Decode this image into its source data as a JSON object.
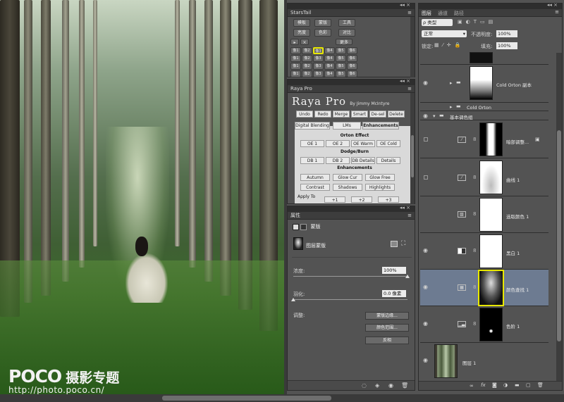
{
  "watermark": {
    "brand": "POCO",
    "sub": "摄影专题",
    "url": "http://photo.poco.cn/"
  },
  "starstail": {
    "title": "StarsTail",
    "row1": [
      "模板",
      "蒙版",
      "工具"
    ],
    "row2": [
      "亮度",
      "色彩",
      "对比"
    ],
    "row3_left": [
      "▸",
      "×"
    ],
    "row3_right": "更多",
    "grid": [
      "像1",
      "像2",
      "像3",
      "像4",
      "像5",
      "像6",
      "像1",
      "像2",
      "像3",
      "像4",
      "像5",
      "像6",
      "像1",
      "像2",
      "像3",
      "像4",
      "像5",
      "像6",
      "像1",
      "像2",
      "像3",
      "像4",
      "像5",
      "像6"
    ]
  },
  "raya": {
    "title": "Raya Pro",
    "logo": "Raya Pro",
    "byline": "By Jimmy McIntyre",
    "toolbar": [
      "Undo",
      "Redo",
      "Merge",
      "Smart",
      "De-sel",
      "Delete"
    ],
    "tabs": [
      "Digital Blending",
      "LMs",
      "Enhancements"
    ],
    "orton_title": "Orton Effect",
    "orton": [
      "OE 1",
      "OE 2",
      "OE Warm",
      "OE Cold"
    ],
    "dodge_title": "Dodge/Burn",
    "dodge": [
      "DB 1",
      "DB 2",
      "DB Details",
      "Details"
    ],
    "enh_title": "Enhancements",
    "enh1": [
      "Autumn",
      "Glow Cur",
      "Glow Free"
    ],
    "enh2": [
      "Contrast",
      "Shadows",
      "Highlights"
    ],
    "apply": "Apply To",
    "apply_btns": [
      "+1",
      "+2",
      "+3"
    ]
  },
  "properties": {
    "title": "属性",
    "tab": "蒙版",
    "mask_label": "图层蒙版",
    "density_label": "浓度:",
    "density_value": "100%",
    "feather_label": "羽化:",
    "feather_value": "0.0 像素",
    "refine_label": "调整:",
    "btn_edge": "蒙版边缘...",
    "btn_range": "颜色范围...",
    "btn_invert": "反相"
  },
  "layers": {
    "tabs": [
      "图层",
      "通道",
      "路径"
    ],
    "kind": "ρ 类型",
    "blend": "正常",
    "opacity_label": "不透明度:",
    "opacity_value": "100%",
    "lock_label": "锁定:",
    "fill_label": "填充:",
    "fill_value": "100%",
    "rows": [
      {
        "name": "Cold Orton 副本"
      },
      {
        "name": "Cold Orton"
      },
      {
        "name": "基本调色组"
      },
      {
        "name": "暗部调整..."
      },
      {
        "name": "曲线 1"
      },
      {
        "name": "选取颜色 1"
      },
      {
        "name": "黑白 1"
      },
      {
        "name": "颜色查找 1"
      },
      {
        "name": "色阶 1"
      },
      {
        "name": "图层 1"
      }
    ],
    "footer_icons": [
      "link-icon",
      "fx-icon",
      "mask-icon",
      "adjustment-icon",
      "group-icon",
      "new-layer-icon",
      "trash-icon"
    ]
  },
  "colors": {
    "highlight": "#e8e800",
    "selected_row": "#6d7b91",
    "panel": "#535353"
  }
}
